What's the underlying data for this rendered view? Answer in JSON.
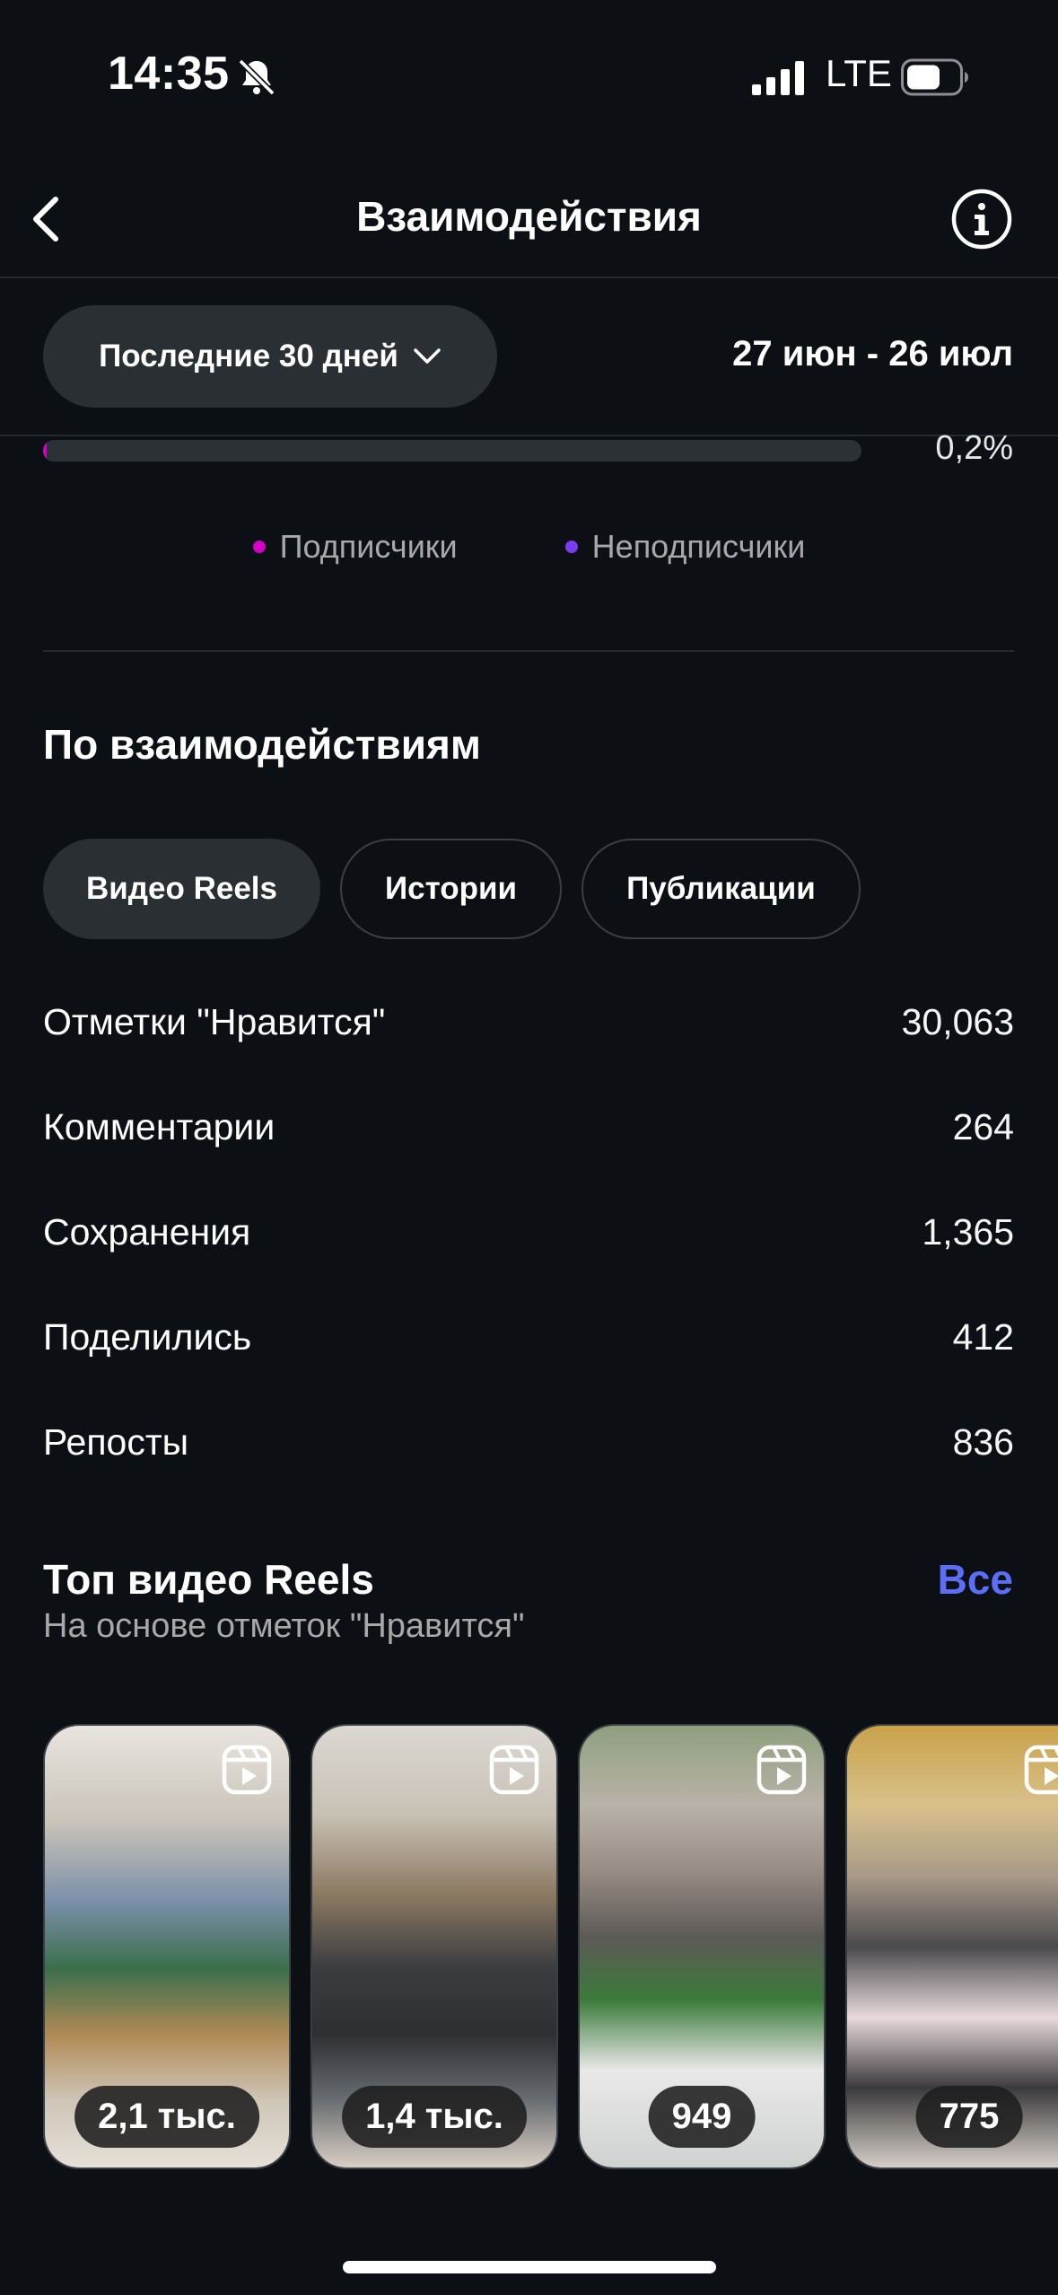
{
  "status_bar": {
    "time": "14:35",
    "network": "LTE",
    "icons": [
      "bell-off-icon",
      "signal-icon",
      "battery-icon"
    ]
  },
  "header": {
    "title": "Взаимодействия",
    "back_icon": "chevron-left-icon",
    "info_icon": "info-icon"
  },
  "filters": {
    "range_label": "Последние 30 дней",
    "range_icon": "chevron-down-icon",
    "date_range": "27 июн - 26 июл"
  },
  "audience": {
    "progress_percent": 0.2,
    "progress_label": "0,2%",
    "legend": [
      {
        "label": "Подписчики",
        "color": "#d300c5"
      },
      {
        "label": "Неподписчики",
        "color": "#7a3cf0"
      }
    ]
  },
  "breakdown": {
    "title": "По взаимодействиям",
    "tabs": [
      {
        "label": "Видео Reels",
        "active": true
      },
      {
        "label": "Истории",
        "active": false
      },
      {
        "label": "Публикации",
        "active": false
      }
    ],
    "metrics": [
      {
        "label": "Отметки \"Нравится\"",
        "value": "30,063"
      },
      {
        "label": "Комментарии",
        "value": "264"
      },
      {
        "label": "Сохранения",
        "value": "1,365"
      },
      {
        "label": "Поделились",
        "value": "412"
      },
      {
        "label": "Репосты",
        "value": "836"
      }
    ]
  },
  "top_reels": {
    "title": "Топ видео Reels",
    "subtitle": "На основе отметок \"Нравится\"",
    "all_label": "Все",
    "accent_color": "#5b6ef5",
    "items": [
      {
        "count": "2,1 тыс.",
        "icon": "reels-icon"
      },
      {
        "count": "1,4 тыс.",
        "icon": "reels-icon"
      },
      {
        "count": "949",
        "icon": "reels-icon"
      },
      {
        "count": "775",
        "icon": "reels-icon"
      }
    ]
  }
}
